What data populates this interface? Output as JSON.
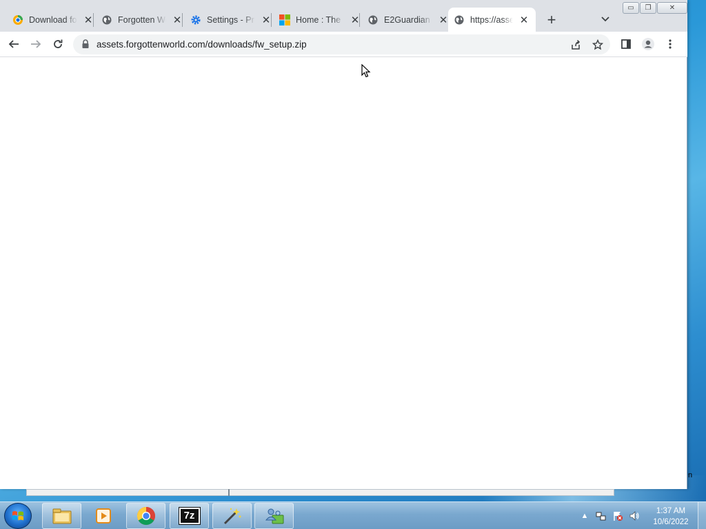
{
  "browser": {
    "tabs": [
      {
        "label": "Download for free",
        "favicon": "chrome-canary-icon"
      },
      {
        "label": "Forgotten World",
        "favicon": "globe-icon"
      },
      {
        "label": "Settings - Privacy",
        "favicon": "gear-icon"
      },
      {
        "label": "Home : The",
        "favicon": "microsoft-icon"
      },
      {
        "label": "E2Guardian",
        "favicon": "globe-icon"
      },
      {
        "label": "https://assets",
        "favicon": "globe-icon",
        "active": true
      }
    ],
    "close_glyph": "✕",
    "new_tab_glyph": "+",
    "address": {
      "url": "assets.forgottenworld.com/downloads/fw_setup.zip"
    },
    "window_controls": {
      "minimize": "▭",
      "restore": "❐",
      "close": "✕"
    }
  },
  "desktop": {
    "edge_label": "n"
  },
  "taskbar": {
    "pinned": [
      "file-explorer-icon",
      "media-player-icon",
      "chrome-icon",
      "7zip-icon",
      "wand-icon",
      "network-people-icon"
    ],
    "sevenzip_label": "7z",
    "clock": {
      "time": "1:37 AM",
      "date": "10/6/2022"
    },
    "tray_arrow": "▲"
  },
  "colors": {
    "tabstrip": "#dee1e6",
    "omnibox": "#f1f3f4",
    "taskbar": "#7aa8cf"
  }
}
